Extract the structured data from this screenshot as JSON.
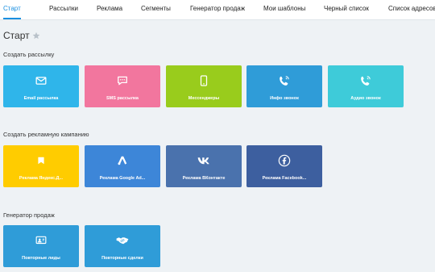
{
  "nav": {
    "tabs": [
      {
        "label": "Старт"
      },
      {
        "label": "Рассылки"
      },
      {
        "label": "Реклама"
      },
      {
        "label": "Сегменты"
      },
      {
        "label": "Генератор продаж"
      },
      {
        "label": "Мои шаблоны"
      },
      {
        "label": "Черный список"
      },
      {
        "label": "Список адресов"
      }
    ]
  },
  "page": {
    "title": "Старт"
  },
  "sections": [
    {
      "title": "Создать рассылку",
      "tiles": [
        {
          "label": "Email рассылка",
          "icon": "email-icon",
          "color": "#2fb5ea"
        },
        {
          "label": "SMS рассылка",
          "icon": "sms-icon",
          "color": "#f2769e"
        },
        {
          "label": "Мессенджеры",
          "icon": "phone-icon",
          "color": "#99cc1c"
        },
        {
          "label": "Инфо звонок",
          "icon": "phone-call-icon",
          "color": "#2f9cd8"
        },
        {
          "label": "Аудио звонок",
          "icon": "audio-call-icon",
          "color": "#3ecbd9"
        }
      ]
    },
    {
      "title": "Создать рекламную кампанию",
      "tiles": [
        {
          "label": "Реклама Яндекс.Д...",
          "icon": "yandex-icon",
          "color": "#ffcc00"
        },
        {
          "label": "Реклама Google Ad...",
          "icon": "google-ads-icon",
          "color": "#3d86d8"
        },
        {
          "label": "Реклама ВКонтакте",
          "icon": "vk-icon",
          "color": "#4a72ad"
        },
        {
          "label": "Реклама Facebook...",
          "icon": "facebook-icon",
          "color": "#3d5f9f"
        }
      ]
    },
    {
      "title": "Генератор продаж",
      "tiles": [
        {
          "label": "Повторные лиды",
          "icon": "leads-icon",
          "color": "#2f9cd8"
        },
        {
          "label": "Повторные сделки",
          "icon": "handshake-icon",
          "color": "#2f9cd8"
        }
      ]
    }
  ]
}
